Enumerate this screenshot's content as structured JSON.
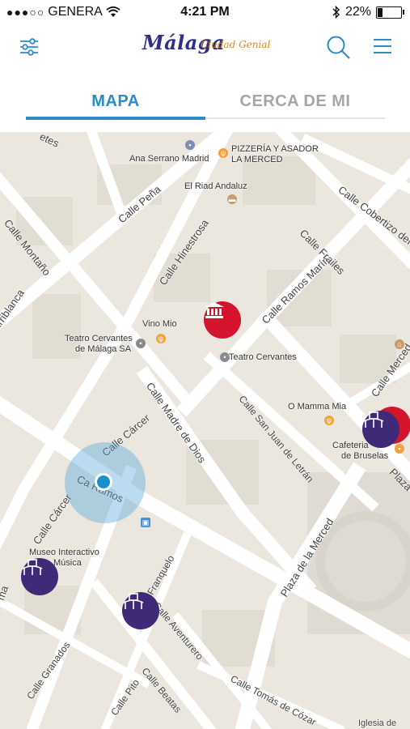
{
  "status_bar": {
    "carrier": "GENERA",
    "time": "4:21 PM",
    "battery": "22%",
    "battery_level": 0.22
  },
  "header": {
    "logo_word": "Málaga",
    "logo_tagline": "Ciudad Genial"
  },
  "tabs": [
    {
      "label": "MAPA",
      "active": true
    },
    {
      "label": "CERCA DE MI",
      "active": false
    }
  ],
  "colors": {
    "accent": "#2b8cc6",
    "marker_red": "#d3142c",
    "marker_purple": "#3f2a78"
  },
  "map": {
    "places": {
      "ana_serrano": "Ana Serrano Madrid",
      "pizzeria_1": "PIZZERÍA Y ASADOR",
      "pizzeria_2": "LA MERCED",
      "riad": "El Riad Andaluz",
      "vino_mio": "Vino Mio",
      "teatro_sa_1": "Teatro Cervantes",
      "teatro_sa_2": "de Málaga SA",
      "teatro": "Teatro Cervantes",
      "mamma_mia": "O Mamma Mia",
      "cafeteria_1": "Cafeteria",
      "cafeteria_2": "de Bruselas",
      "museo_1": "Museo Interactivo",
      "museo_2": "Música"
    },
    "streets": {
      "pena": "Calle Peña",
      "montano": "Calle Montaño",
      "hinestrosa": "Calle Hinestrosa",
      "ramos_marin": "Calle Ramos Marín",
      "frailes": "Calle Frailes",
      "cobertizo": "Calle Cobertizo del Conde",
      "madre_dios": "Calle Madre de Dios",
      "san_juan": "Calle San Juan de Letrán",
      "carcer_1": "Calle Cárcer",
      "carcer_2": "Calle Cárcer",
      "ramos": "Ca    Ramos",
      "merced": "Calle Merced",
      "plaza_merced": "Plaza de la Merced",
      "plaza": "Plaza",
      "franquelo": "Calle Franquelo",
      "aventurero": "Calle Aventurero",
      "granados": "Calle Granados",
      "beatas": "Calle Beatas",
      "pito": "Calle Pito",
      "tomas": "Calle Tomás de Cózar",
      "arriblanca": "arriblanca",
      "etes": "etes",
      "ma": "ma",
      "iglesia": "Iglesia de"
    }
  }
}
